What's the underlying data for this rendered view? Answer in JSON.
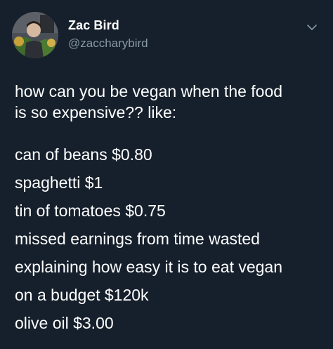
{
  "user": {
    "display_name": "Zac Bird",
    "handle": "@zaccharybird",
    "avatar_icon": "profile-photo"
  },
  "tweet": {
    "intro_lines": [
      "how can you be vegan when the food",
      "is so expensive?? like:"
    ],
    "list_lines": [
      "can of beans $0.80",
      "spaghetti $1",
      "tin of tomatoes $0.75",
      "missed earnings from time wasted",
      "explaining how easy it is to eat vegan",
      "on a budget $120k",
      "olive oil $3.00"
    ]
  },
  "menu": {
    "icon": "chevron-down-icon"
  },
  "colors": {
    "background": "#16202c",
    "text": "#ffffff",
    "secondary_text": "#8899a6"
  }
}
